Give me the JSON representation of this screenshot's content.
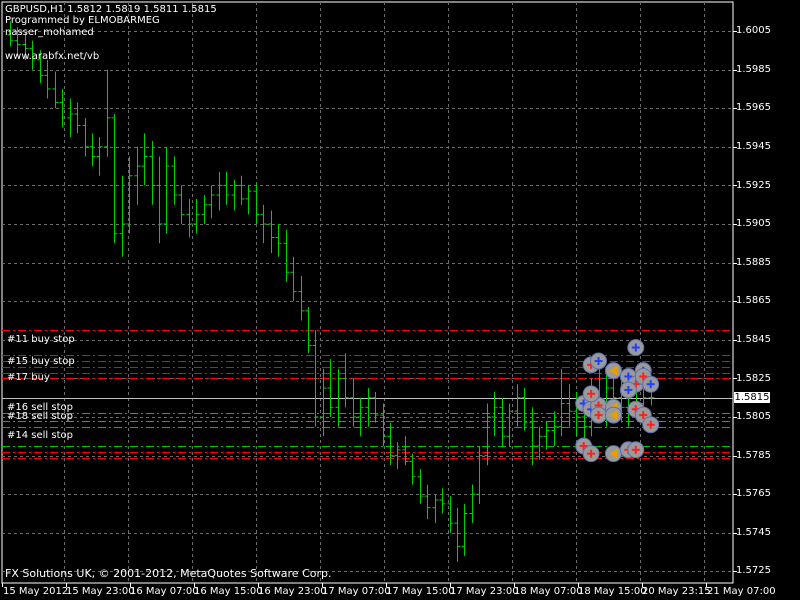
{
  "header": {
    "symbol_line": "GBPUSD,H1  1.5812 1.5819 1.5811 1.5815",
    "programmer": "Programmed by ELMOBARMEG",
    "author": "nasser_mohamed",
    "url": "www.arabfx.net/vb"
  },
  "copyright": "FX Solutions UK, © 2001-2012, MetaQuotes Software Corp.",
  "current_price": "1.5815",
  "colors": {
    "background": "#000000",
    "grid": "#6b6b6b",
    "candle": "#00d000",
    "buy_stop_line": "#ff0000",
    "sell_stop_line": "#00c000",
    "bid_line": "#c0c0c0",
    "marker_disc": "#9a9a9a"
  },
  "level_labels": [
    {
      "text": "#11 buy stop",
      "price": 1.5841
    },
    {
      "text": "#15 buy stop",
      "price": 1.5832
    },
    {
      "text": "#17 buy",
      "price": 1.5823
    },
    {
      "text": "#16 sell stop",
      "price": 1.581
    },
    {
      "text": "#18 sell stop",
      "price": 1.5805
    },
    {
      "text": "#14 sell stop",
      "price": 1.5793
    }
  ],
  "chart_data": {
    "type": "bar",
    "title": "GBPUSD,H1",
    "ohlc_last": {
      "open": 1.5812,
      "high": 1.5819,
      "low": 1.5811,
      "close": 1.5815
    },
    "ylim": [
      1.572,
      1.601
    ],
    "y_ticks": [
      "1.6005",
      "1.5985",
      "1.5965",
      "1.5945",
      "1.5925",
      "1.5905",
      "1.5885",
      "1.5865",
      "1.5845",
      "1.5825",
      "1.5805",
      "1.5785",
      "1.5765",
      "1.5745",
      "1.5725"
    ],
    "x_ticks": [
      "15 May 2012",
      "15 May 23:00",
      "16 May 07:00",
      "16 May 15:00",
      "16 May 23:00",
      "17 May 07:00",
      "17 May 15:00",
      "17 May 23:00",
      "18 May 07:00",
      "18 May 15:00",
      "20 May 23:15",
      "21 May 07:00"
    ],
    "red_lines": [
      1.585,
      1.5837,
      1.5834,
      1.5831,
      1.5828,
      1.5825,
      1.579,
      1.5787,
      1.5784
    ],
    "green_lines": [
      1.5807,
      1.5803,
      1.58,
      1.579
    ],
    "bid_line": 1.5815,
    "bars": [
      [
        1.6003,
        1.601,
        1.5997,
        1.6
      ],
      [
        1.6,
        1.6007,
        1.5992,
        1.5998
      ],
      [
        1.5998,
        1.6004,
        1.599,
        1.5996
      ],
      [
        1.5996,
        1.6,
        1.5985,
        1.599
      ],
      [
        1.599,
        1.5995,
        1.5978,
        1.5982
      ],
      [
        1.5982,
        1.599,
        1.597,
        1.5975
      ],
      [
        1.5975,
        1.5984,
        1.5965,
        1.5968
      ],
      [
        1.5968,
        1.5975,
        1.5955,
        1.596
      ],
      [
        1.596,
        1.597,
        1.595,
        1.5962
      ],
      [
        1.5962,
        1.5968,
        1.5952,
        1.5956
      ],
      [
        1.5956,
        1.596,
        1.594,
        1.5945
      ],
      [
        1.5945,
        1.5952,
        1.5935,
        1.594
      ],
      [
        1.594,
        1.595,
        1.593,
        1.5945
      ],
      [
        1.5945,
        1.5985,
        1.594,
        1.596
      ],
      [
        1.596,
        1.5962,
        1.5895,
        1.59
      ],
      [
        1.59,
        1.593,
        1.5888,
        1.5905
      ],
      [
        1.5905,
        1.594,
        1.59,
        1.593
      ],
      [
        1.593,
        1.5945,
        1.5915,
        1.5935
      ],
      [
        1.5935,
        1.5952,
        1.5925,
        1.594
      ],
      [
        1.594,
        1.5948,
        1.5915,
        1.5925
      ],
      [
        1.5925,
        1.594,
        1.5895,
        1.5905
      ],
      [
        1.5905,
        1.5945,
        1.59,
        1.5935
      ],
      [
        1.5935,
        1.594,
        1.5915,
        1.592
      ],
      [
        1.592,
        1.5925,
        1.5905,
        1.591
      ],
      [
        1.591,
        1.5918,
        1.5898,
        1.5905
      ],
      [
        1.5905,
        1.5918,
        1.59,
        1.591
      ],
      [
        1.591,
        1.592,
        1.5905,
        1.5915
      ],
      [
        1.5915,
        1.5925,
        1.5908,
        1.592
      ],
      [
        1.592,
        1.5932,
        1.5912,
        1.5925
      ],
      [
        1.5925,
        1.5932,
        1.5915,
        1.592
      ],
      [
        1.592,
        1.5928,
        1.5912,
        1.5925
      ],
      [
        1.5925,
        1.593,
        1.5915,
        1.5918
      ],
      [
        1.5918,
        1.5925,
        1.591,
        1.5922
      ],
      [
        1.5922,
        1.5926,
        1.5905,
        1.591
      ],
      [
        1.591,
        1.5915,
        1.5895,
        1.5905
      ],
      [
        1.5905,
        1.5912,
        1.589,
        1.5898
      ],
      [
        1.5898,
        1.5905,
        1.5888,
        1.5895
      ],
      [
        1.5895,
        1.5902,
        1.5875,
        1.588
      ],
      [
        1.588,
        1.5888,
        1.5865,
        1.587
      ],
      [
        1.587,
        1.5878,
        1.5855,
        1.586
      ],
      [
        1.586,
        1.5862,
        1.5838,
        1.5842
      ],
      [
        1.5842,
        1.585,
        1.58,
        1.5805
      ],
      [
        1.5805,
        1.583,
        1.5795,
        1.582
      ],
      [
        1.582,
        1.5835,
        1.5805,
        1.581
      ],
      [
        1.581,
        1.583,
        1.58,
        1.5825
      ],
      [
        1.5825,
        1.5838,
        1.581,
        1.5815
      ],
      [
        1.5815,
        1.5825,
        1.58,
        1.5805
      ],
      [
        1.5805,
        1.5815,
        1.5795,
        1.581
      ],
      [
        1.581,
        1.582,
        1.58,
        1.5815
      ],
      [
        1.5815,
        1.5818,
        1.5802,
        1.5806
      ],
      [
        1.5806,
        1.5812,
        1.579,
        1.5795
      ],
      [
        1.5795,
        1.5802,
        1.578,
        1.5785
      ],
      [
        1.5785,
        1.5792,
        1.5778,
        1.5788
      ],
      [
        1.5788,
        1.5795,
        1.578,
        1.5782
      ],
      [
        1.5782,
        1.5786,
        1.577,
        1.5774
      ],
      [
        1.5774,
        1.5778,
        1.576,
        1.5764
      ],
      [
        1.5764,
        1.577,
        1.5752,
        1.5758
      ],
      [
        1.5758,
        1.5765,
        1.575,
        1.5762
      ],
      [
        1.5762,
        1.5768,
        1.5755,
        1.576
      ],
      [
        1.576,
        1.5764,
        1.5745,
        1.575
      ],
      [
        1.575,
        1.5758,
        1.573,
        1.5738
      ],
      [
        1.5738,
        1.576,
        1.5733,
        1.5755
      ],
      [
        1.5755,
        1.577,
        1.575,
        1.5765
      ],
      [
        1.5765,
        1.579,
        1.576,
        1.5785
      ],
      [
        1.5785,
        1.5812,
        1.578,
        1.5805
      ],
      [
        1.5805,
        1.5818,
        1.5795,
        1.581
      ],
      [
        1.581,
        1.5815,
        1.579,
        1.5795
      ],
      [
        1.5795,
        1.5812,
        1.579,
        1.5808
      ],
      [
        1.5808,
        1.5822,
        1.58,
        1.5815
      ],
      [
        1.5815,
        1.582,
        1.5798,
        1.5802
      ],
      [
        1.5802,
        1.581,
        1.578,
        1.579
      ],
      [
        1.579,
        1.58,
        1.5783,
        1.5795
      ],
      [
        1.5795,
        1.5803,
        1.5788,
        1.5798
      ],
      [
        1.5798,
        1.5808,
        1.579,
        1.58
      ],
      [
        1.58,
        1.583,
        1.5795,
        1.5812
      ],
      [
        1.5812,
        1.5822,
        1.58,
        1.5808
      ],
      [
        1.5808,
        1.5818,
        1.5795,
        1.5805
      ],
      [
        1.5805,
        1.5815,
        1.579,
        1.58
      ],
      [
        1.58,
        1.5825,
        1.5795,
        1.5818
      ],
      [
        1.5818,
        1.583,
        1.5805,
        1.5812
      ],
      [
        1.5812,
        1.5828,
        1.58,
        1.582
      ],
      [
        1.582,
        1.583,
        1.5808,
        1.5815
      ],
      [
        1.5815,
        1.5826,
        1.5802,
        1.581
      ],
      [
        1.581,
        1.5825,
        1.58,
        1.5818
      ],
      [
        1.5818,
        1.5828,
        1.5806,
        1.5812
      ],
      [
        1.5812,
        1.582,
        1.5805,
        1.5815
      ],
      [
        1.5815,
        1.5819,
        1.5811,
        1.5815
      ]
    ],
    "markers": [
      {
        "bar": 78,
        "price": 1.5832,
        "kind": "red"
      },
      {
        "bar": 79,
        "price": 1.5834,
        "kind": "blue"
      },
      {
        "bar": 77,
        "price": 1.5812,
        "kind": "blue"
      },
      {
        "bar": 78,
        "price": 1.5809,
        "kind": "blue"
      },
      {
        "bar": 79,
        "price": 1.5811,
        "kind": "red"
      },
      {
        "bar": 78,
        "price": 1.5817,
        "kind": "red"
      },
      {
        "bar": 79,
        "price": 1.5806,
        "kind": "red"
      },
      {
        "bar": 81,
        "price": 1.581,
        "kind": "left"
      },
      {
        "bar": 81,
        "price": 1.5806,
        "kind": "left"
      },
      {
        "bar": 81,
        "price": 1.5829,
        "kind": "left"
      },
      {
        "bar": 77,
        "price": 1.579,
        "kind": "red"
      },
      {
        "bar": 78,
        "price": 1.5786,
        "kind": "red"
      },
      {
        "bar": 81,
        "price": 1.5786,
        "kind": "left"
      },
      {
        "bar": 84,
        "price": 1.5841,
        "kind": "blue"
      },
      {
        "bar": 83,
        "price": 1.5826,
        "kind": "blue"
      },
      {
        "bar": 84,
        "price": 1.5822,
        "kind": "red"
      },
      {
        "bar": 83,
        "price": 1.5819,
        "kind": "blue"
      },
      {
        "bar": 85,
        "price": 1.5829,
        "kind": "blue"
      },
      {
        "bar": 85,
        "price": 1.5826,
        "kind": "red"
      },
      {
        "bar": 86,
        "price": 1.5822,
        "kind": "blue"
      },
      {
        "bar": 84,
        "price": 1.5809,
        "kind": "red"
      },
      {
        "bar": 85,
        "price": 1.5806,
        "kind": "red"
      },
      {
        "bar": 86,
        "price": 1.5801,
        "kind": "red"
      },
      {
        "bar": 83,
        "price": 1.5788,
        "kind": "red"
      },
      {
        "bar": 84,
        "price": 1.5788,
        "kind": "red"
      }
    ]
  }
}
